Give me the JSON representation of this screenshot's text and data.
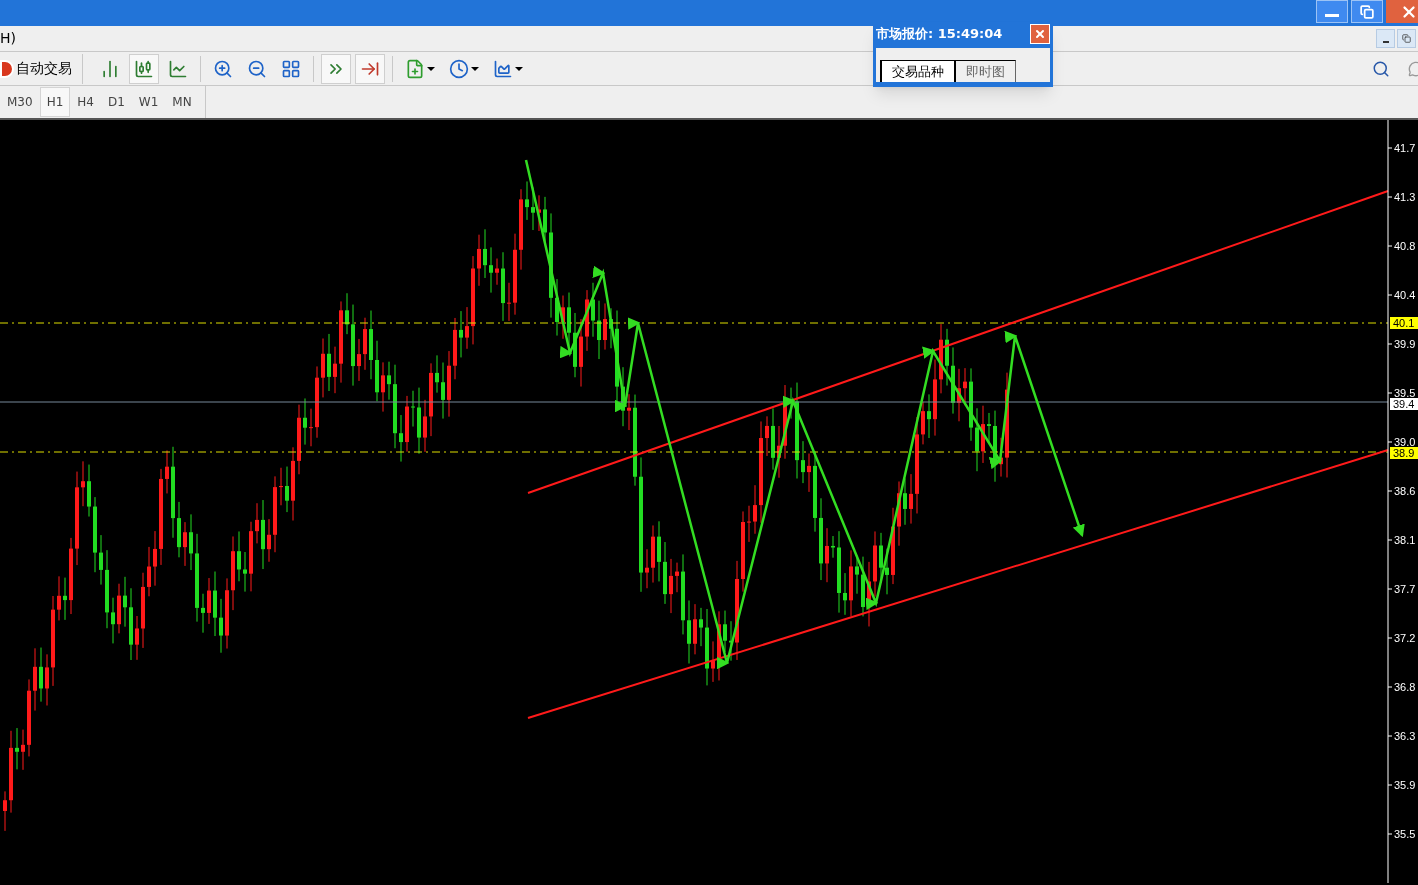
{
  "menu_bar": {
    "items": [
      "H)"
    ]
  },
  "toolbar": {
    "auto_trade": "自动交易",
    "tools": [
      {
        "kind": "bar",
        "pressed": false
      },
      {
        "kind": "candle",
        "pressed": true
      },
      {
        "kind": "line",
        "pressed": false
      },
      {
        "kind": "zoom-in",
        "pressed": false
      },
      {
        "kind": "zoom-out",
        "pressed": false
      },
      {
        "kind": "tile",
        "pressed": false
      },
      {
        "kind": "autoscroll",
        "pressed": true
      },
      {
        "kind": "shift",
        "pressed": true
      },
      {
        "kind": "indicator",
        "pressed": false
      },
      {
        "kind": "periods",
        "pressed": false
      },
      {
        "kind": "template",
        "pressed": false
      }
    ]
  },
  "timeframes": [
    {
      "label": "M30",
      "selected": false
    },
    {
      "label": "H1",
      "selected": true
    },
    {
      "label": "H4",
      "selected": false
    },
    {
      "label": "D1",
      "selected": false
    },
    {
      "label": "W1",
      "selected": false
    },
    {
      "label": "MN",
      "selected": false
    }
  ],
  "market_watch": {
    "title": "市场报价: 15:49:04",
    "tabs": [
      {
        "label": "交易品种",
        "selected": true
      },
      {
        "label": "即时图",
        "selected": false
      }
    ]
  },
  "price_axis": {
    "labels": [
      "41.7",
      "41.3",
      "40.8",
      "40.4",
      "39.9",
      "39.5",
      "39.0",
      "38.6",
      "38.1",
      "37.7",
      "37.2",
      "36.8",
      "36.3",
      "35.9",
      "35.5"
    ]
  },
  "price_tags": [
    {
      "label": "40.1",
      "color": "#ffff00"
    },
    {
      "label": "39.4",
      "color": "#ffffff"
    },
    {
      "label": "38.9",
      "color": "#ffff00"
    }
  ]
}
